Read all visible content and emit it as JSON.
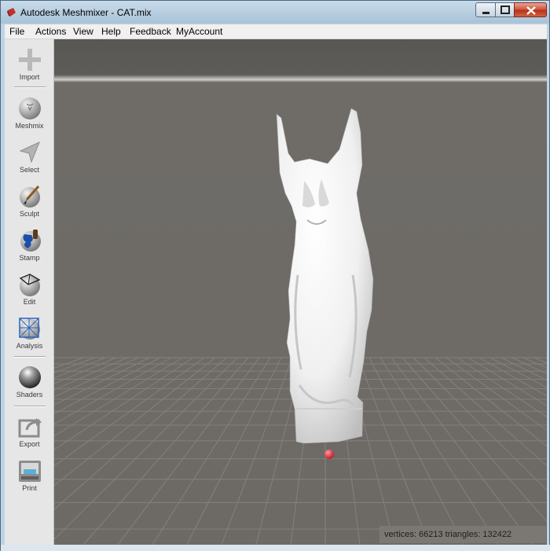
{
  "window": {
    "title": "Autodesk Meshmixer - CAT.mix"
  },
  "menu": {
    "items": [
      "File",
      "Actions",
      "View",
      "Help",
      "Feedback",
      "MyAccount"
    ]
  },
  "toolbar": {
    "tools": [
      {
        "label": "Import",
        "icon": "plus-icon"
      },
      {
        "label": "Meshmix",
        "icon": "meshmix-sphere-icon"
      },
      {
        "label": "Select",
        "icon": "select-arrow-icon"
      },
      {
        "label": "Sculpt",
        "icon": "sculpt-brush-icon"
      },
      {
        "label": "Stamp",
        "icon": "stamp-icon"
      },
      {
        "label": "Edit",
        "icon": "edit-sphere-icon"
      },
      {
        "label": "Analysis",
        "icon": "analysis-grid-icon"
      },
      {
        "label": "Shaders",
        "icon": "shader-ball-icon"
      },
      {
        "label": "Export",
        "icon": "export-icon"
      },
      {
        "label": "Print",
        "icon": "printer-icon"
      }
    ]
  },
  "status": {
    "text": "vertices: 66213 triangles: 132422"
  },
  "colors": {
    "viewport": "#6d6a66",
    "toolbar": "#e6e6e6",
    "pivot": "#e0303a",
    "close": "#c74a30"
  }
}
